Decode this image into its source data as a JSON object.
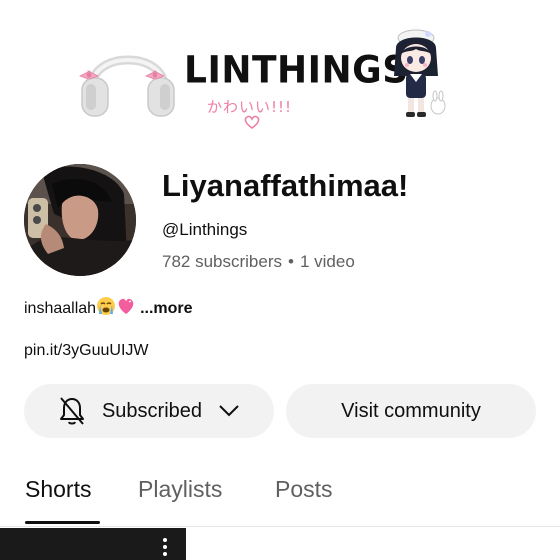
{
  "banner": {
    "title": "LINTHINGS",
    "subtitle": "かわいい!!!",
    "icons": [
      "headphones-icon",
      "heart-doodle-icon",
      "chibi-character"
    ]
  },
  "channel": {
    "name": "Liyanaffathimaa!",
    "handle": "@Linthings",
    "subscribers": "782 subscribers",
    "separator": "•",
    "videos": "1 video",
    "description": "inshaallah",
    "description_emoji": [
      "crying-face",
      "pink-heart"
    ],
    "more_label": "...more",
    "link": "pin.it/3yGuuUIJW"
  },
  "buttons": {
    "subscribed_label": "Subscribed",
    "community_label": "Visit community"
  },
  "tabs": [
    {
      "label": "Shorts",
      "active": true
    },
    {
      "label": "Playlists",
      "active": false
    },
    {
      "label": "Posts",
      "active": false
    }
  ],
  "colors": {
    "text": "#0f0f0f",
    "secondary_text": "#606060",
    "button_bg": "#f2f2f2",
    "banner_pink": "#ef7ea6"
  }
}
